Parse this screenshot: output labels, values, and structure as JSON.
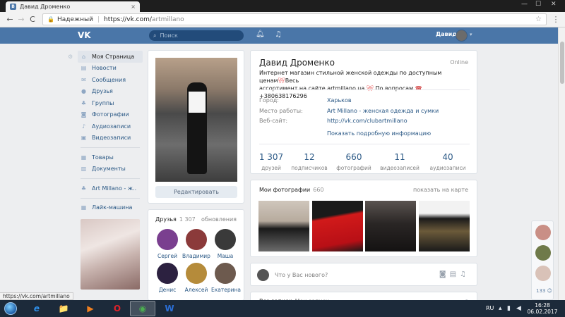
{
  "browser": {
    "tab_title": "Давид Дроменко",
    "tab_favicon": "В",
    "tab_close": "×",
    "window_controls": [
      "—",
      "☐",
      "✕"
    ],
    "back": "←",
    "forward": "→",
    "reload": "C",
    "secure_label": "Надежный",
    "url_host": "https://vk.com/",
    "url_path": "artmillano",
    "menu": "⋮",
    "status_url": "https://vk.com/artmillano"
  },
  "vk_header": {
    "logo": "VK",
    "search_placeholder": "Поиск",
    "user_name": "Давид"
  },
  "left_menu": {
    "items_main": [
      {
        "label": "Моя Страница",
        "icon": "home-icon"
      },
      {
        "label": "Новости",
        "icon": "news-icon"
      },
      {
        "label": "Сообщения",
        "icon": "messages-icon"
      },
      {
        "label": "Друзья",
        "icon": "friends-icon"
      },
      {
        "label": "Группы",
        "icon": "groups-icon"
      },
      {
        "label": "Фотографии",
        "icon": "photos-icon"
      },
      {
        "label": "Аудиозаписи",
        "icon": "audio-icon"
      },
      {
        "label": "Видеозаписи",
        "icon": "video-icon"
      }
    ],
    "items_secondary": [
      {
        "label": "Товары",
        "icon": "goods-icon"
      },
      {
        "label": "Документы",
        "icon": "docs-icon"
      }
    ],
    "group_item": "Art Millano - ж..",
    "app_item": "Лайк-машина"
  },
  "profile": {
    "edit_button": "Редактировать",
    "name": "Давид Дроменко",
    "online": "Online",
    "status_line1": "Интернет магазин стильной женской одежды по доступным ценам",
    "status_line2_a": "ассортимент на сайте artmillano.ua",
    "status_line2_b": " По вопросам ",
    "status_phone": "+380638176296",
    "status_tail": "Весь",
    "city_label": "Город:",
    "city_value": "Харьков",
    "work_label": "Место работы:",
    "work_value": "Art Millano - женская одежда и сумки",
    "site_label": "Веб-сайт:",
    "site_value": "http://vk.com/clubartmillano",
    "more_info": "Показать подробную информацию",
    "stats": [
      {
        "value": "1 307",
        "label": "друзей"
      },
      {
        "value": "12",
        "label": "подписчиков"
      },
      {
        "value": "660",
        "label": "фотографий"
      },
      {
        "value": "11",
        "label": "видеозаписей"
      },
      {
        "value": "40",
        "label": "аудиозаписи"
      }
    ]
  },
  "friends": {
    "title": "Друзья",
    "count": "1 307",
    "updates": "обновления",
    "people": [
      {
        "name": "Сергей",
        "color": "#7a3f8f"
      },
      {
        "name": "Владимир",
        "color": "#8b3a3a"
      },
      {
        "name": "Маша",
        "color": "#3a3a3a"
      },
      {
        "name": "Денис",
        "color": "#2c2140"
      },
      {
        "name": "Алексей",
        "color": "#b58b3a"
      },
      {
        "name": "Екатерина",
        "color": "#6d5a4e"
      }
    ]
  },
  "photos": {
    "title": "Мои фотографии",
    "count": "660",
    "map_link": "показать на карте"
  },
  "post": {
    "placeholder": "Что у Вас нового?"
  },
  "wall": {
    "title": "Все записи",
    "subtitle": "Мои записи"
  },
  "chats": {
    "count": "133"
  },
  "taskbar": {
    "apps": [
      "e",
      "📁",
      "▶",
      "O",
      "◉",
      "W"
    ],
    "lang": "RU",
    "time": "16:28",
    "date": "06.02.2017"
  }
}
